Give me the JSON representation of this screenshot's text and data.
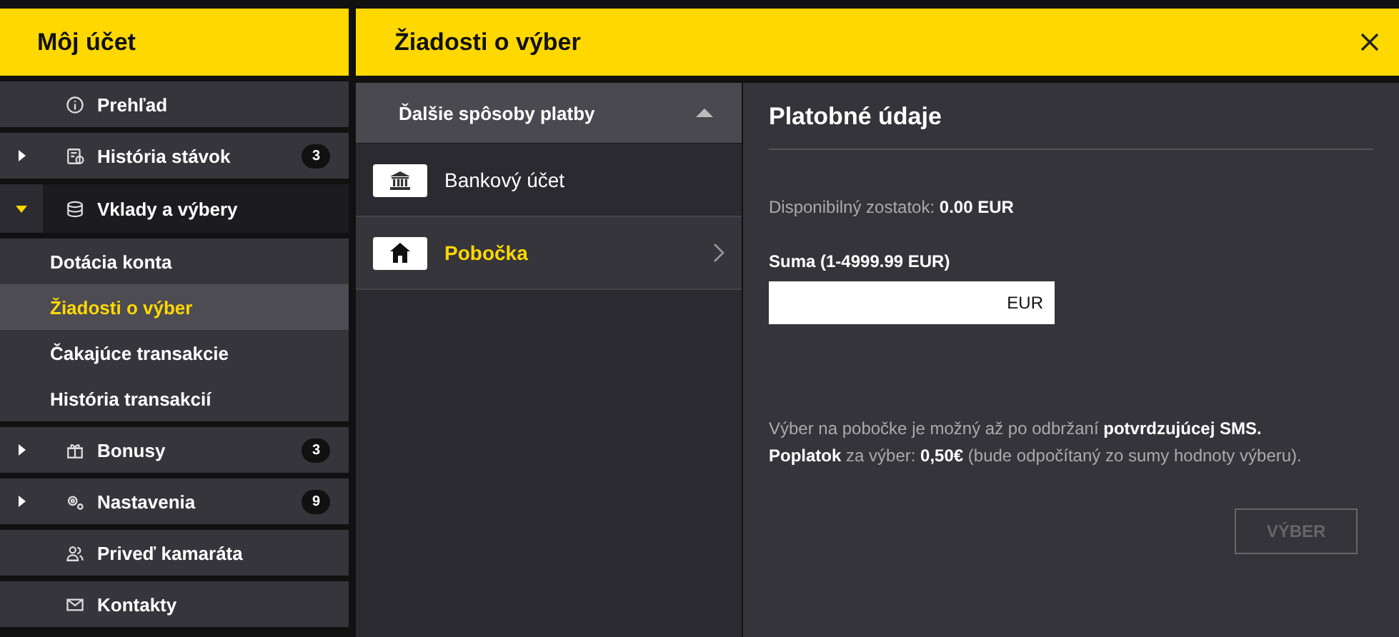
{
  "sidebar": {
    "title": "Môj účet",
    "items": [
      {
        "label": "Prehľad"
      },
      {
        "label": "História stávok",
        "expanded": false,
        "badge": "3"
      },
      {
        "label": "Vklady a výbery",
        "expanded": true,
        "children": [
          {
            "label": "Dotácia konta",
            "selected": false
          },
          {
            "label": "Žiadosti o výber",
            "selected": true
          },
          {
            "label": "Čakajúce transakcie",
            "selected": false
          },
          {
            "label": "História transakcií",
            "selected": false
          }
        ]
      },
      {
        "label": "Bonusy",
        "expanded": false,
        "badge": "3"
      },
      {
        "label": "Nastavenia",
        "expanded": false,
        "badge": "9"
      },
      {
        "label": "Priveď kamaráta"
      },
      {
        "label": "Kontakty"
      }
    ]
  },
  "header": {
    "title": "Žiadosti o výber"
  },
  "payment_methods": {
    "title": "Ďalšie spôsoby platby",
    "expanded": true,
    "items": [
      {
        "label": "Bankový účet",
        "selected": false
      },
      {
        "label": "Pobočka",
        "selected": true
      }
    ]
  },
  "details": {
    "title": "Platobné údaje",
    "balance": "Disponibilný zostatok: **0.00 EUR**",
    "amount_label": "Suma (1-4999.99 EUR)",
    "amount_currency": "EUR",
    "notes": [
      "Výber na pobočke je možný až po odbržaní **potvrdzujúcej SMS.**",
      "**Poplatok** za výber: **0,50€** (bude odpočítaný zo sumy hodnoty výberu)."
    ],
    "submit": {
      "label": "VÝBER",
      "disabled": true
    }
  }
}
